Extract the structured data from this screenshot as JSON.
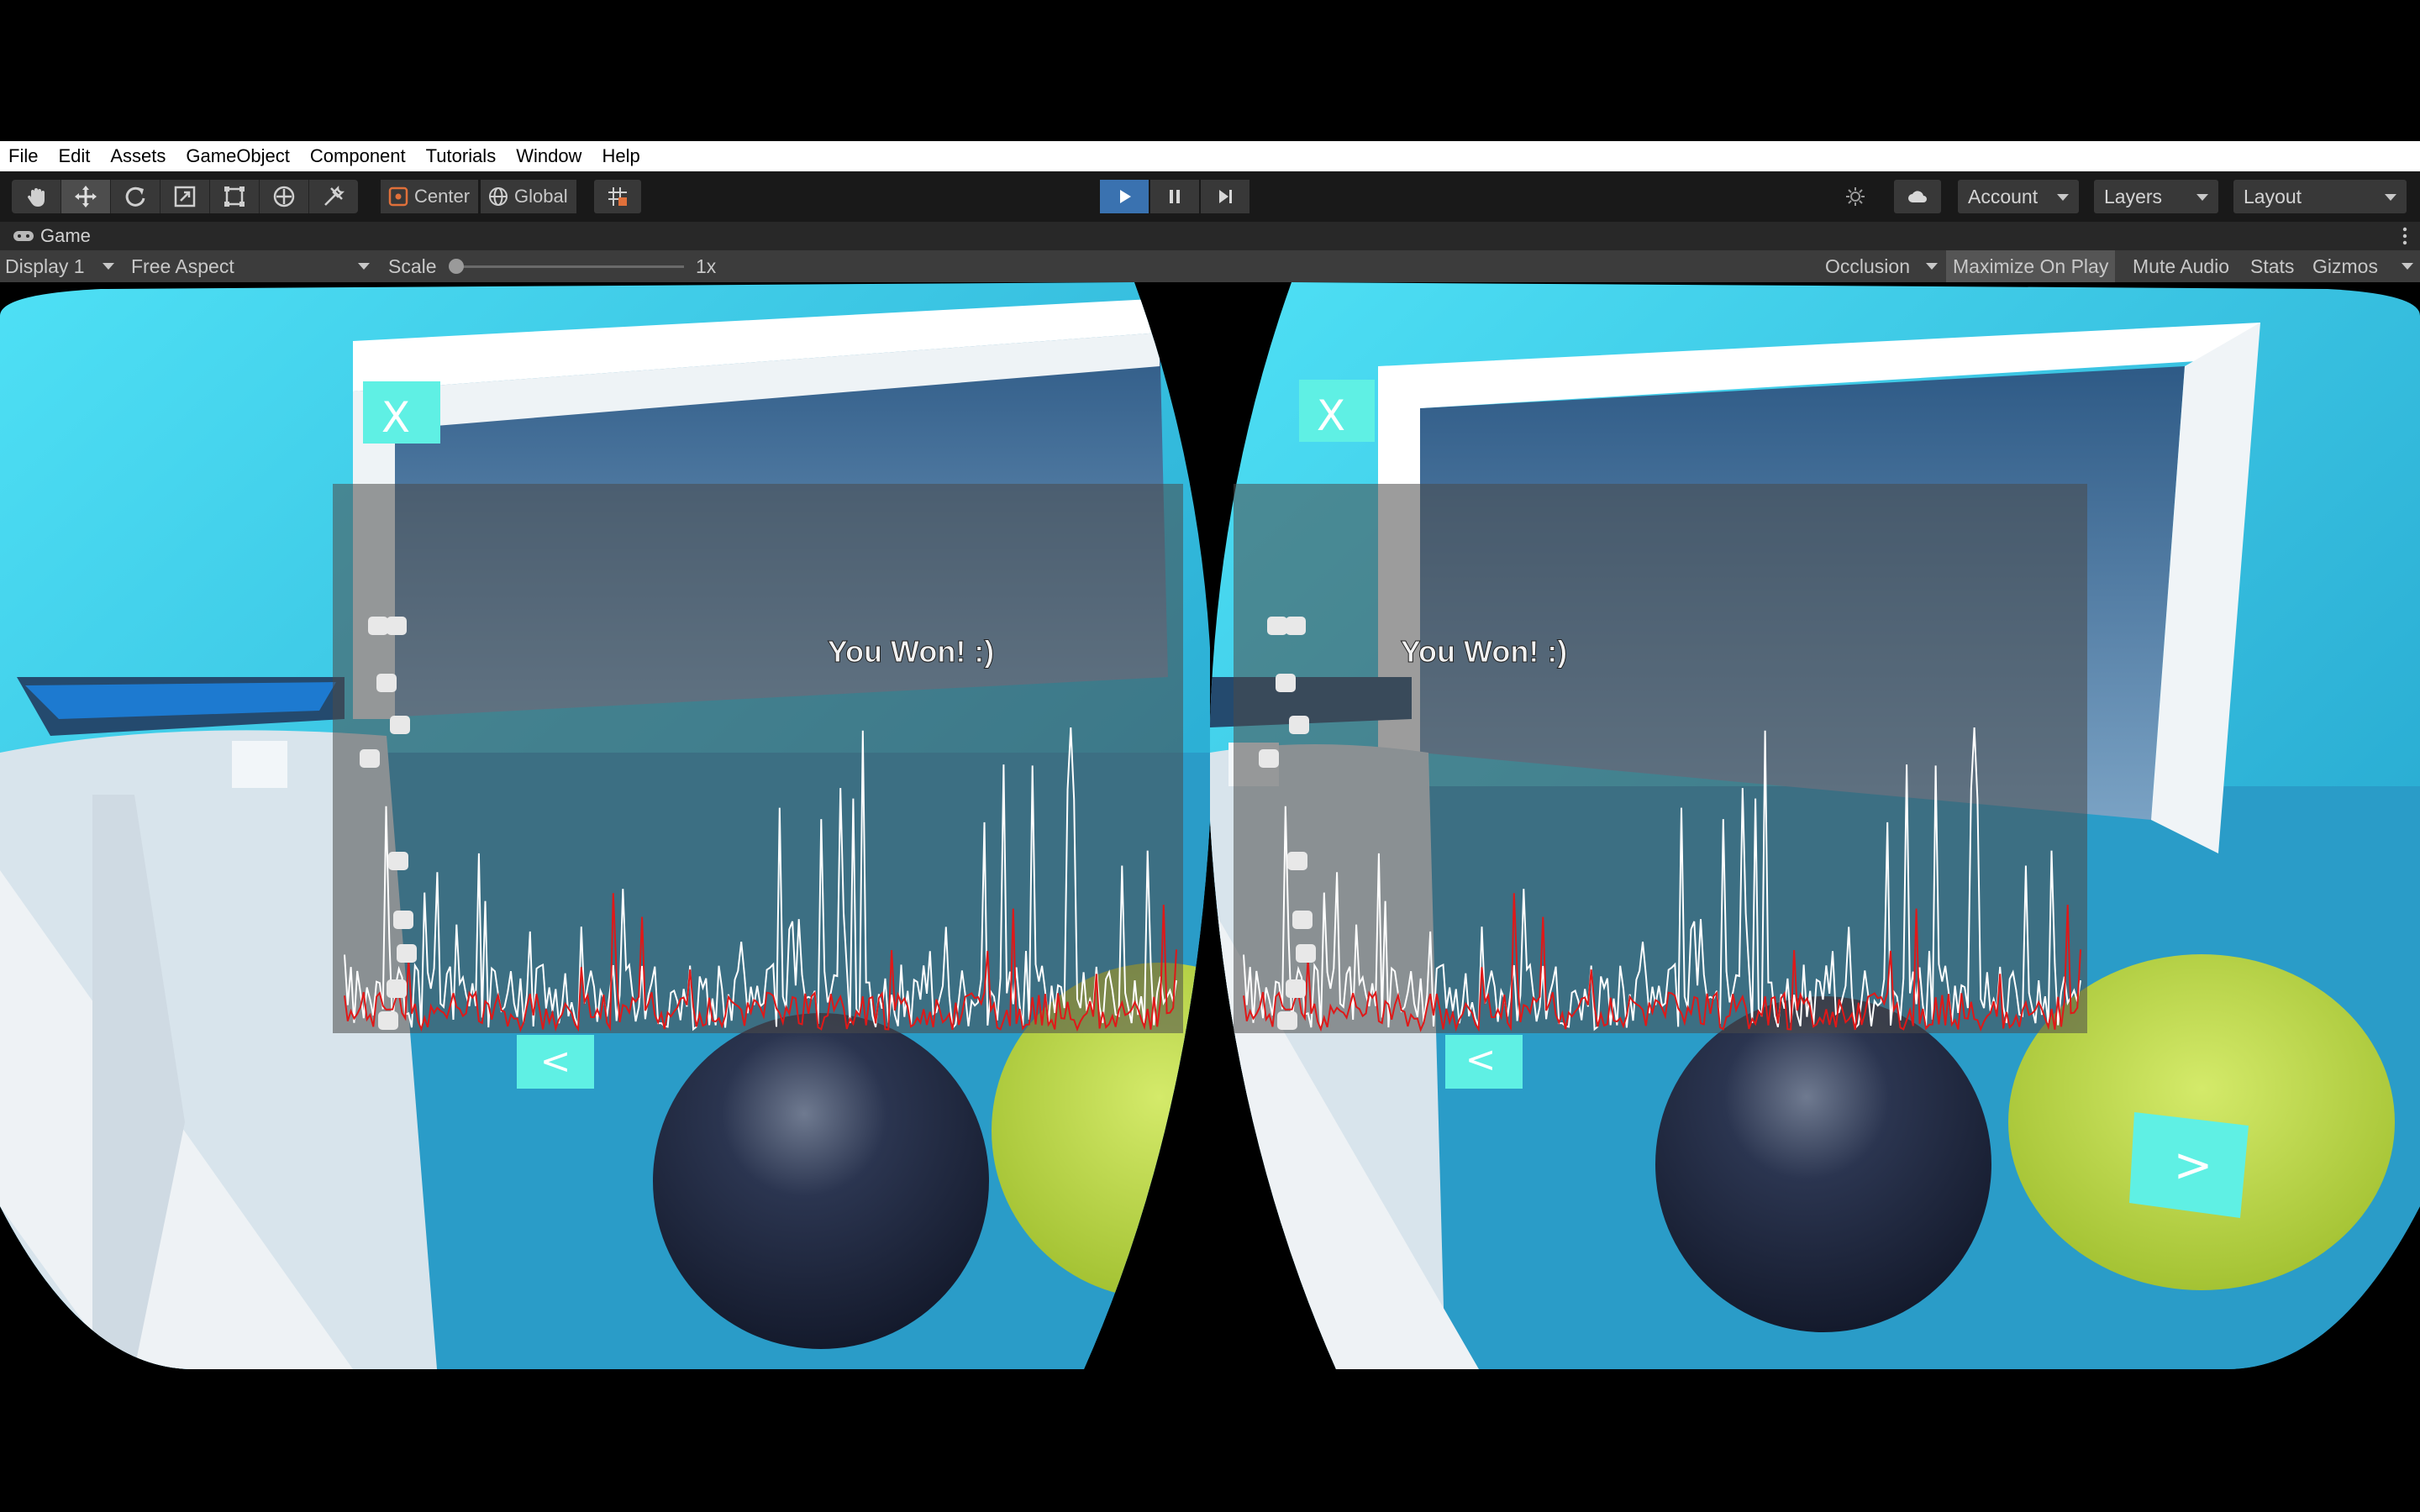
{
  "menu": [
    "File",
    "Edit",
    "Assets",
    "GameObject",
    "Component",
    "Tutorials",
    "Window",
    "Help"
  ],
  "toolbar": {
    "tools": [
      "hand-icon",
      "move-icon",
      "rotate-icon",
      "scale-icon",
      "rect-icon",
      "transform-icon",
      "custom-tool-icon"
    ],
    "pivot": "Center",
    "space": "Global",
    "account": "Account",
    "layers": "Layers",
    "layout": "Layout"
  },
  "game_tab": {
    "label": "Game"
  },
  "game_bar": {
    "display": "Display 1",
    "aspect": "Free Aspect",
    "scale_label": "Scale",
    "scale_value": "1x",
    "occlusion": "Occlusion",
    "maximize": "Maximize On Play",
    "mute": "Mute Audio",
    "stats": "Stats",
    "gizmos": "Gizmos"
  },
  "game": {
    "left_eye": {
      "message": "You Won! :)",
      "close_glyph": "X",
      "prev_glyph": "<"
    },
    "right_eye": {
      "message": "You Won! :)",
      "close_glyph": "X",
      "prev_glyph": "<",
      "next_glyph": ">"
    }
  },
  "colors": {
    "play_active": "#3a72b0",
    "sky": "#3ec6e6",
    "button_cyan": "#5ff0e4",
    "ball_dark": "#2b3550",
    "ball_lime": "#b8d640",
    "waveform_white": "#ffffff",
    "waveform_red": "#e01818"
  }
}
